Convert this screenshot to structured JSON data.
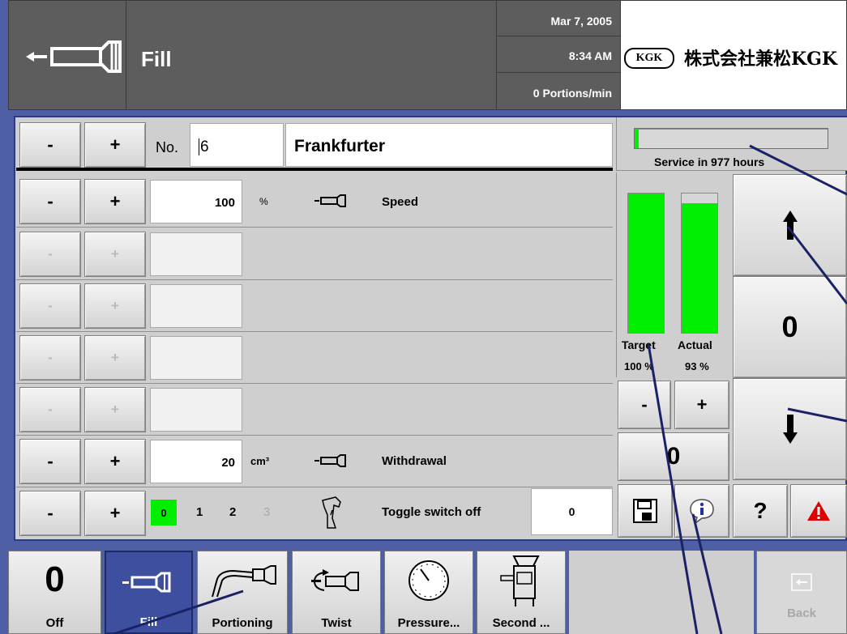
{
  "header": {
    "title": "Fill",
    "date": "Mar 7, 2005",
    "time": "8:34 AM",
    "rate": "0 Portions/min",
    "logo_text": "KGK",
    "company_name": "株式会社兼松KGK"
  },
  "program": {
    "minus": "-",
    "plus": "+",
    "no_label": "No.",
    "no_value": "6",
    "name": "Frankfurter"
  },
  "rows": [
    {
      "minus": "-",
      "plus": "+",
      "value": "100",
      "unit": "%",
      "label": "Speed"
    },
    {
      "minus": "-",
      "plus": "+"
    },
    {
      "minus": "-",
      "plus": "+"
    },
    {
      "minus": "-",
      "plus": "+"
    },
    {
      "minus": "-",
      "plus": "+"
    },
    {
      "minus": "-",
      "plus": "+",
      "value": "20",
      "unit": "cm³",
      "label": "Withdrawal"
    },
    {
      "minus": "-",
      "plus": "+",
      "options": [
        "0",
        "1",
        "2",
        "3"
      ],
      "selected": "0",
      "label": "Toggle switch off",
      "value": "0"
    }
  ],
  "service": {
    "text": "Service in 977 hours",
    "progress_fraction": 0.02
  },
  "gauges": {
    "target_label": "Target",
    "actual_label": "Actual",
    "target_value": "100 %",
    "actual_value": "93 %",
    "target_fraction": 1.0,
    "actual_fraction": 0.93,
    "minus": "-",
    "plus": "+",
    "counter": "0"
  },
  "right": {
    "up_icon": "arrow-up-icon",
    "counter": "0",
    "down_icon": "arrow-down-icon",
    "help": "?"
  },
  "bottom_nav": [
    {
      "label": "Off",
      "icon_text": "0",
      "active": false
    },
    {
      "label": "Fill",
      "active": true
    },
    {
      "label": "Portioning",
      "active": false
    },
    {
      "label": "Twist",
      "active": false
    },
    {
      "label": "Pressure...",
      "active": false
    },
    {
      "label": "Second ...",
      "active": false
    }
  ],
  "back": {
    "label": "Back"
  },
  "colors": {
    "background": "#4e5fa5",
    "header": "#5d5d5d",
    "panel": "#cfcfcf",
    "green": "#00ee00",
    "active_nav": "#3d4f9e",
    "warning": "#e00000"
  }
}
